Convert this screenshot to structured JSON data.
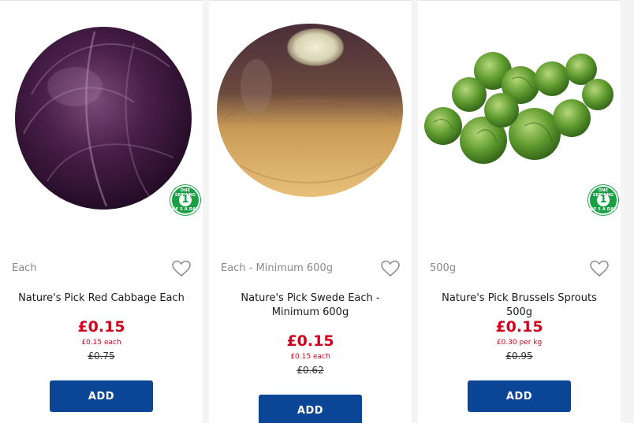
{
  "products": [
    {
      "image": "red-cabbage-image",
      "badge": {
        "number": "1",
        "top_text": "ONE SERVING",
        "bottom_text": "OF 5 A DAY"
      },
      "weight": "Each",
      "name": "Nature's Pick Red Cabbage Each",
      "price": "£0.15",
      "unit_price": "£0.15 each",
      "was_price": "£0.75",
      "add_label": "ADD"
    },
    {
      "image": "swede-image",
      "weight": "Each - Minimum 600g",
      "name": "Nature's Pick Swede Each - Minimum 600g",
      "price": "£0.15",
      "unit_price": "£0.15 each",
      "was_price": "£0.62",
      "add_label": "ADD"
    },
    {
      "image": "brussels-sprouts-image",
      "badge": {
        "number": "1",
        "top_text": "ONE SERVING",
        "bottom_text": "OF 5 A DAY"
      },
      "weight": "500g",
      "name": "Nature's Pick Brussels Sprouts 500g",
      "price": "£0.15",
      "unit_price": "£0.30 per kg",
      "was_price": "£0.95",
      "add_label": "ADD"
    }
  ],
  "colors": {
    "price_red": "#d0021b",
    "button_blue": "#0b4595",
    "badge_green": "#19a043",
    "muted_text": "#8a8a8a"
  },
  "icons": {
    "favourite": "heart-outline-icon"
  }
}
